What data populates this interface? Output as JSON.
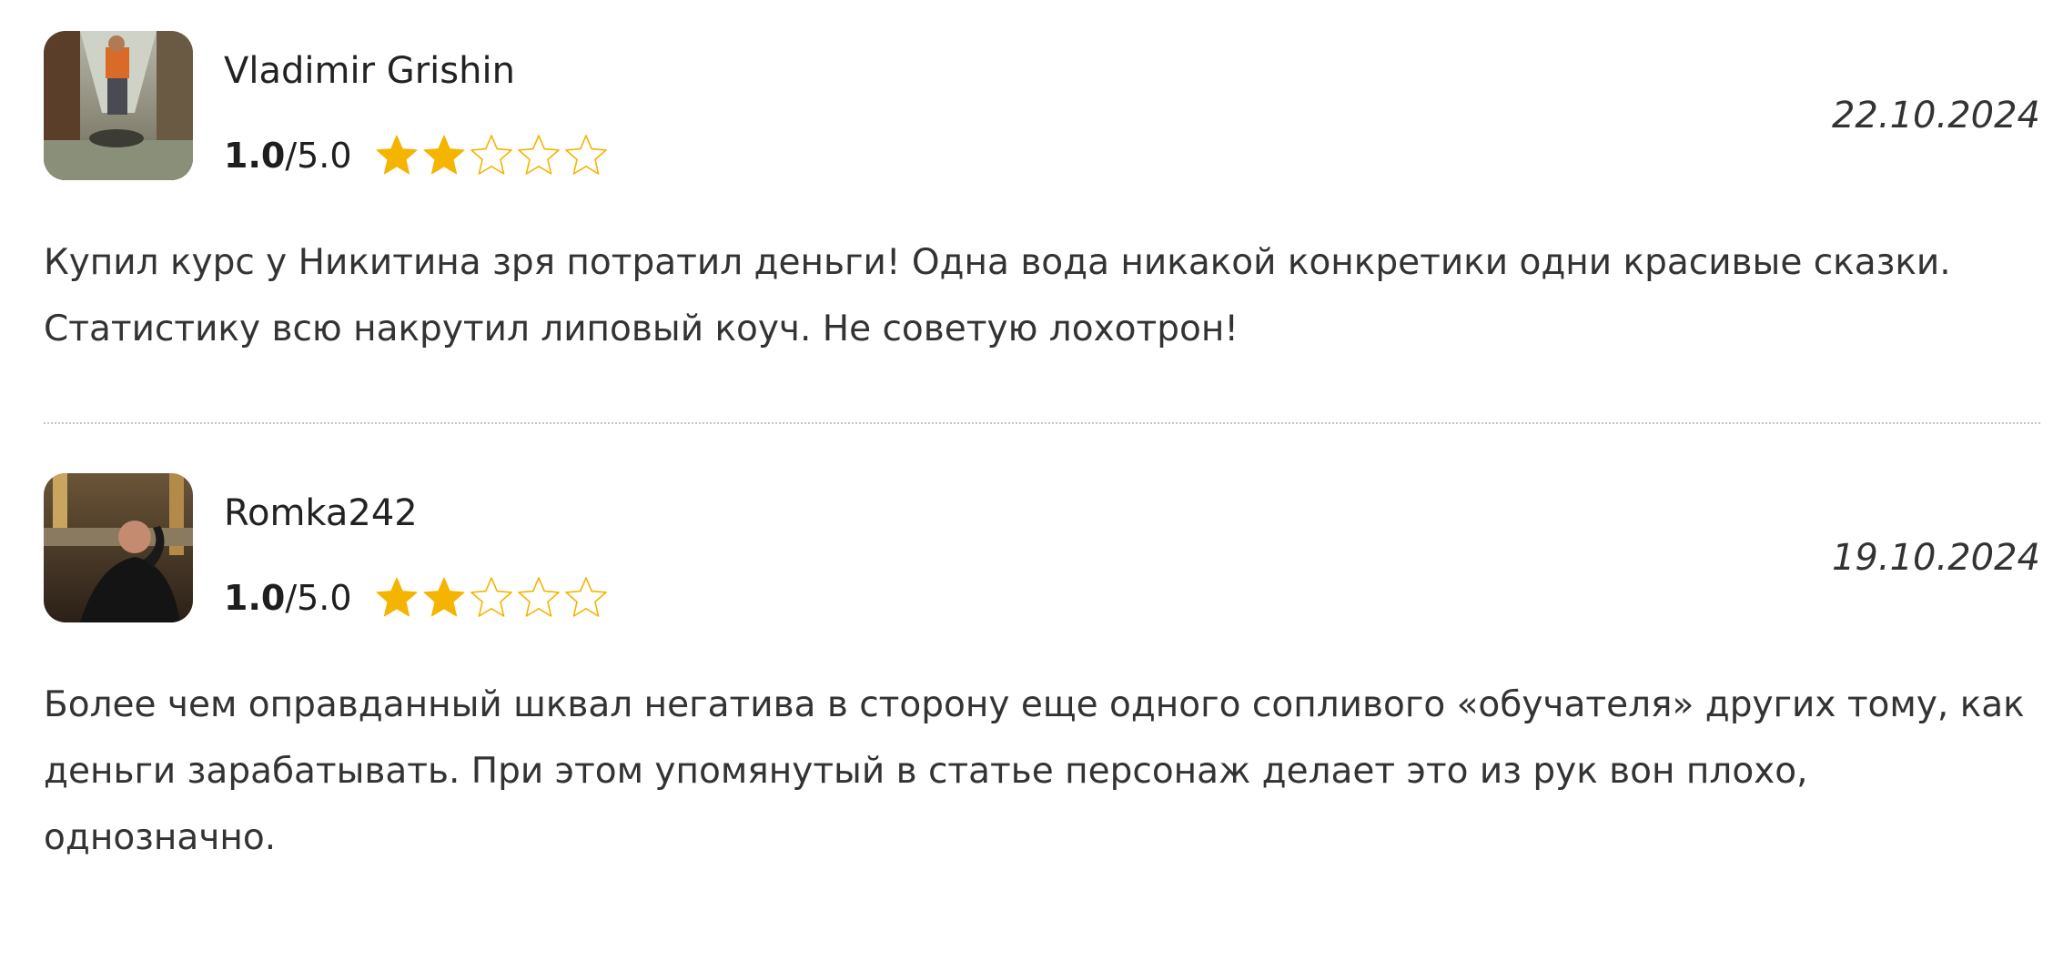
{
  "reviews": [
    {
      "author": "Vladimir Grishin",
      "score": "1.0",
      "score_max": "/5.0",
      "stars_filled": 2,
      "stars_total": 5,
      "date": "22.10.2024",
      "text": "Купил курс у Никитина зря потратил деньги! Одна вода никакой конкретики одни красивые сказки. Статистику всю накрутил липовый коуч. Не советую лохотрон!"
    },
    {
      "author": "Romka242",
      "score": "1.0",
      "score_max": "/5.0",
      "stars_filled": 2,
      "stars_total": 5,
      "date": "19.10.2024",
      "text": "Более чем оправданный шквал негатива в сторону еще одного сопливого «обучателя» других тому, как деньги зарабатывать. При этом упомянутый в статье персонаж делает это из рук вон плохо, однозначно."
    }
  ],
  "colors": {
    "star_filled": "#f5b400",
    "star_empty_stroke": "#f5b400",
    "divider": "#c4c4c4",
    "text": "#333333"
  },
  "icons": {
    "star_filled": "star-filled-icon",
    "star_empty": "star-empty-icon"
  }
}
